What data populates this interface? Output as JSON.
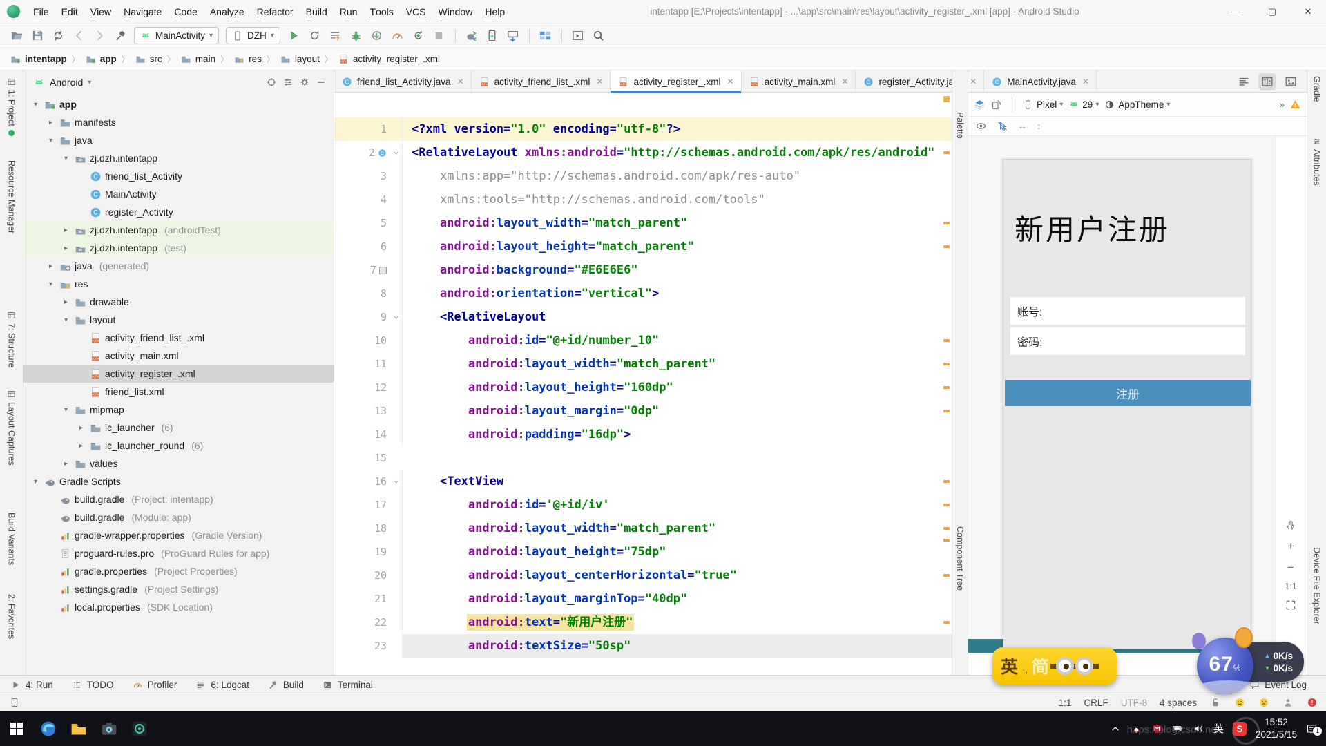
{
  "titlebar": {
    "menus": [
      {
        "label": "File",
        "u": 0
      },
      {
        "label": "Edit",
        "u": 0
      },
      {
        "label": "View",
        "u": 0
      },
      {
        "label": "Navigate",
        "u": 0
      },
      {
        "label": "Code",
        "u": 0
      },
      {
        "label": "Analyze",
        "u": 5
      },
      {
        "label": "Refactor",
        "u": 0
      },
      {
        "label": "Build",
        "u": 0
      },
      {
        "label": "Run",
        "u": 1
      },
      {
        "label": "Tools",
        "u": 0
      },
      {
        "label": "VCS",
        "u": 2
      },
      {
        "label": "Window",
        "u": 0
      },
      {
        "label": "Help",
        "u": 0
      }
    ],
    "title": "intentapp [E:\\Projects\\intentapp] - ...\\app\\src\\main\\res\\layout\\activity_register_.xml [app] - Android Studio",
    "window_buttons": [
      "minimize",
      "maximize",
      "close"
    ]
  },
  "toolbar": {
    "left_icons": [
      "open",
      "save",
      "sync",
      "back",
      "fwd",
      "hammer"
    ],
    "run_config": "MainActivity",
    "device": "DZH",
    "run_icons": [
      "play",
      "apply",
      "profilelines",
      "bug",
      "attachg",
      "gauge",
      "debugrestart",
      "stop"
    ],
    "tool_icons": [
      "syncgradle",
      "avd",
      "sdk"
    ],
    "extra_icons": [
      "structure"
    ],
    "last_icons": [
      "runwin",
      "search"
    ]
  },
  "breadcrumbs": [
    {
      "label": "intentapp",
      "icon": "module",
      "bold": true
    },
    {
      "label": "app",
      "icon": "module",
      "bold": true
    },
    {
      "label": "src",
      "icon": "folder"
    },
    {
      "label": "main",
      "icon": "folder"
    },
    {
      "label": "res",
      "icon": "res"
    },
    {
      "label": "layout",
      "icon": "folder"
    },
    {
      "label": "activity_register_.xml",
      "icon": "xml"
    }
  ],
  "left_stripe": [
    "1: Project",
    "Resource Manager",
    "7: Structure",
    "Layout Captures",
    "Build Variants",
    "2: Favorites"
  ],
  "right_stripe": [
    "Gradle",
    "Attributes",
    "Device File Explorer"
  ],
  "palette_strip": {
    "top": "Palette",
    "bottom": "Component Tree"
  },
  "project": {
    "selector": "Android",
    "tree": [
      {
        "indent": 0,
        "arrow": "down",
        "icon": "module",
        "label": "app",
        "bold": true
      },
      {
        "indent": 1,
        "arrow": "right",
        "icon": "folder",
        "label": "manifests"
      },
      {
        "indent": 1,
        "arrow": "down",
        "icon": "folder",
        "label": "java"
      },
      {
        "indent": 2,
        "arrow": "down",
        "icon": "pkg",
        "label": "zj.dzh.intentapp"
      },
      {
        "indent": 3,
        "icon": "class",
        "label": "friend_list_Activity"
      },
      {
        "indent": 3,
        "icon": "class",
        "label": "MainActivity"
      },
      {
        "indent": 3,
        "icon": "class",
        "label": "register_Activity"
      },
      {
        "indent": 2,
        "arrow": "right",
        "icon": "pkg",
        "label": "zj.dzh.intentapp",
        "extra": "(androidTest)",
        "bg": "green"
      },
      {
        "indent": 2,
        "arrow": "right",
        "icon": "pkg",
        "label": "zj.dzh.intentapp",
        "extra": "(test)",
        "bg": "green"
      },
      {
        "indent": 1,
        "arrow": "right",
        "icon": "gen",
        "label": "java",
        "extra": "(generated)"
      },
      {
        "indent": 1,
        "arrow": "down",
        "icon": "res",
        "label": "res"
      },
      {
        "indent": 2,
        "arrow": "right",
        "icon": "folder",
        "label": "drawable"
      },
      {
        "indent": 2,
        "arrow": "down",
        "icon": "folder",
        "label": "layout"
      },
      {
        "indent": 3,
        "icon": "xml",
        "label": "activity_friend_list_.xml"
      },
      {
        "indent": 3,
        "icon": "xml",
        "label": "activity_main.xml"
      },
      {
        "indent": 3,
        "icon": "xml",
        "label": "activity_register_.xml",
        "bg": "sel"
      },
      {
        "indent": 3,
        "icon": "xml",
        "label": "friend_list.xml"
      },
      {
        "indent": 2,
        "arrow": "down",
        "icon": "folder",
        "label": "mipmap"
      },
      {
        "indent": 3,
        "arrow": "right",
        "icon": "folder",
        "label": "ic_launcher",
        "extra": "(6)"
      },
      {
        "indent": 3,
        "arrow": "right",
        "icon": "folder",
        "label": "ic_launcher_round",
        "extra": "(6)"
      },
      {
        "indent": 2,
        "arrow": "right",
        "icon": "folder",
        "label": "values"
      },
      {
        "indent": 0,
        "arrow": "down",
        "icon": "gradle",
        "label": "Gradle Scripts"
      },
      {
        "indent": 1,
        "icon": "gradle",
        "label": "build.gradle",
        "extra": "(Project: intentapp)"
      },
      {
        "indent": 1,
        "icon": "gradle",
        "label": "build.gradle",
        "extra": "(Module: app)"
      },
      {
        "indent": 1,
        "icon": "props",
        "label": "gradle-wrapper.properties",
        "extra": "(Gradle Version)"
      },
      {
        "indent": 1,
        "icon": "file",
        "label": "proguard-rules.pro",
        "extra": "(ProGuard Rules for app)"
      },
      {
        "indent": 1,
        "icon": "props",
        "label": "gradle.properties",
        "extra": "(Project Properties)"
      },
      {
        "indent": 1,
        "icon": "props",
        "label": "settings.gradle",
        "extra": "(Project Settings)"
      },
      {
        "indent": 1,
        "icon": "props",
        "label": "local.properties",
        "extra": "(SDK Location)"
      }
    ]
  },
  "editor": {
    "tabs": [
      {
        "icon": "class",
        "label": "friend_list_Activity.java"
      },
      {
        "icon": "xml",
        "label": "activity_friend_list_.xml"
      },
      {
        "icon": "xml",
        "label": "activity_register_.xml",
        "active": true
      },
      {
        "icon": "xml",
        "label": "activity_main.xml"
      },
      {
        "icon": "class",
        "label": "register_Activity.java"
      },
      {
        "icon": "class",
        "label": "MainActivity.java"
      }
    ],
    "code": {
      "lines": [
        {
          "n": 1,
          "ind": 0,
          "bg": "cream",
          "seg": [
            [
              "<?xml version=",
              "t"
            ],
            [
              "\"1.0\"",
              "v"
            ],
            [
              " encoding=",
              "t"
            ],
            [
              "\"utf-8\"",
              "v"
            ],
            [
              "?>",
              "t"
            ]
          ]
        },
        {
          "n": 2,
          "ind": 0,
          "g": [
            "class",
            "fold"
          ],
          "seg": [
            [
              "<RelativeLayout ",
              "t"
            ],
            [
              "xmlns:android",
              "ns"
            ],
            [
              "=",
              "t"
            ],
            [
              "\"http://schemas.android.com/apk/res/android\"",
              "v"
            ]
          ]
        },
        {
          "n": 3,
          "ind": 1,
          "seg": [
            [
              "xmlns:app=\"http://schemas.android.com/apk/res-auto\"",
              "g"
            ]
          ]
        },
        {
          "n": 4,
          "ind": 1,
          "seg": [
            [
              "xmlns:tools=\"http://schemas.android.com/tools\"",
              "g"
            ]
          ]
        },
        {
          "n": 5,
          "ind": 1,
          "seg": [
            [
              "android:",
              "ns"
            ],
            [
              "layout_width",
              "a"
            ],
            [
              "=",
              "t"
            ],
            [
              "\"match_parent\"",
              "v"
            ]
          ]
        },
        {
          "n": 6,
          "ind": 1,
          "seg": [
            [
              "android:",
              "ns"
            ],
            [
              "layout_height",
              "a"
            ],
            [
              "=",
              "t"
            ],
            [
              "\"match_parent\"",
              "v"
            ]
          ]
        },
        {
          "n": 7,
          "ind": 1,
          "g": [
            "chip"
          ],
          "seg": [
            [
              "android:",
              "ns"
            ],
            [
              "background",
              "a"
            ],
            [
              "=",
              "t"
            ],
            [
              "\"#E6E6E6\"",
              "v"
            ]
          ]
        },
        {
          "n": 8,
          "ind": 1,
          "seg": [
            [
              "android:",
              "ns"
            ],
            [
              "orientation",
              "a"
            ],
            [
              "=",
              "t"
            ],
            [
              "\"vertical\"",
              "v"
            ],
            [
              ">",
              "t"
            ]
          ]
        },
        {
          "n": 9,
          "ind": 1,
          "g": [
            "fold"
          ],
          "seg": [
            [
              "<RelativeLayout",
              "t"
            ]
          ]
        },
        {
          "n": 10,
          "ind": 2,
          "seg": [
            [
              "android:",
              "ns"
            ],
            [
              "id",
              "a"
            ],
            [
              "=",
              "t"
            ],
            [
              "\"@+id/number_10\"",
              "v"
            ]
          ]
        },
        {
          "n": 11,
          "ind": 2,
          "seg": [
            [
              "android:",
              "ns"
            ],
            [
              "layout_width",
              "a"
            ],
            [
              "=",
              "t"
            ],
            [
              "\"match_parent\"",
              "v"
            ]
          ]
        },
        {
          "n": 12,
          "ind": 2,
          "seg": [
            [
              "android:",
              "ns"
            ],
            [
              "layout_height",
              "a"
            ],
            [
              "=",
              "t"
            ],
            [
              "\"160dp\"",
              "v"
            ]
          ]
        },
        {
          "n": 13,
          "ind": 2,
          "seg": [
            [
              "android:",
              "ns"
            ],
            [
              "layout_margin",
              "a"
            ],
            [
              "=",
              "t"
            ],
            [
              "\"0dp\"",
              "v"
            ]
          ]
        },
        {
          "n": 14,
          "ind": 2,
          "seg": [
            [
              "android:",
              "ns"
            ],
            [
              "padding",
              "a"
            ],
            [
              "=",
              "t"
            ],
            [
              "\"16dp\"",
              "v"
            ],
            [
              ">",
              "t"
            ]
          ]
        },
        {
          "n": 15,
          "ind": 0,
          "seg": []
        },
        {
          "n": 16,
          "ind": 1,
          "g": [
            "fold"
          ],
          "seg": [
            [
              "<TextView",
              "t"
            ]
          ]
        },
        {
          "n": 17,
          "ind": 2,
          "seg": [
            [
              "android:",
              "ns"
            ],
            [
              "id",
              "a"
            ],
            [
              "=",
              "t"
            ],
            [
              "'@+id/iv'",
              "v"
            ]
          ]
        },
        {
          "n": 18,
          "ind": 2,
          "seg": [
            [
              "android:",
              "ns"
            ],
            [
              "layout_width",
              "a"
            ],
            [
              "=",
              "t"
            ],
            [
              "\"match_parent\"",
              "v"
            ]
          ]
        },
        {
          "n": 19,
          "ind": 2,
          "seg": [
            [
              "android:",
              "ns"
            ],
            [
              "layout_height",
              "a"
            ],
            [
              "=",
              "t"
            ],
            [
              "\"75dp\"",
              "v"
            ]
          ]
        },
        {
          "n": 20,
          "ind": 2,
          "seg": [
            [
              "android:",
              "ns"
            ],
            [
              "layout_centerHorizontal",
              "a"
            ],
            [
              "=",
              "t"
            ],
            [
              "\"true\"",
              "v"
            ]
          ]
        },
        {
          "n": 21,
          "ind": 2,
          "seg": [
            [
              "android:",
              "ns"
            ],
            [
              "layout_marginTop",
              "a"
            ],
            [
              "=",
              "t"
            ],
            [
              "\"40dp\"",
              "v"
            ]
          ]
        },
        {
          "n": 22,
          "ind": 2,
          "mark": true,
          "seg": [
            [
              "android:",
              "ns"
            ],
            [
              "text",
              "a"
            ],
            [
              "=",
              "t"
            ],
            [
              "\"新用户注册\"",
              "v"
            ]
          ]
        },
        {
          "n": 23,
          "ind": 2,
          "bg": "gray",
          "seg": [
            [
              "android:",
              "ns"
            ],
            [
              "textSize",
              "a"
            ],
            [
              "=",
              "t"
            ],
            [
              "\"50sp\"",
              "v"
            ]
          ]
        }
      ],
      "stripe_lines": [
        2,
        5,
        6,
        10,
        11,
        12,
        13,
        16,
        17,
        18,
        18.5,
        20,
        22
      ]
    }
  },
  "design": {
    "device": "Pixel",
    "api": "29",
    "theme": "AppTheme",
    "overflow": "»",
    "preview": {
      "title": "新用户注册",
      "fields": [
        "账号:",
        "密码:"
      ],
      "button": "注册"
    },
    "zoom_label": "1:1"
  },
  "bottom_bar": {
    "items": [
      {
        "label": "4: Run",
        "u": 0,
        "icon": "playgray"
      },
      {
        "label": "TODO",
        "icon": "todo"
      },
      {
        "label": "Profiler",
        "icon": "gauge"
      },
      {
        "label": "6: Logcat",
        "u": 0,
        "icon": "logcat"
      },
      {
        "label": "Build",
        "icon": "hammerg"
      },
      {
        "label": "Terminal",
        "icon": "terminal"
      }
    ],
    "right": {
      "label": "Event Log",
      "icon": "bubble"
    }
  },
  "status_bar": {
    "items": [
      "1:1",
      "CRLF",
      "UTF-8",
      "4 spaces"
    ],
    "muted": "UTF-8"
  },
  "taskbar": {
    "clock": {
      "time": "15:52",
      "date": "2021/5/15"
    },
    "ime": "英",
    "notification_count": "1",
    "watermark": "https://blog.csdn.net/"
  },
  "widgets": {
    "translate": {
      "from": "英",
      "to": "简"
    },
    "ball": {
      "value": "67",
      "unit": "%"
    },
    "net": {
      "up": "0K/s",
      "down": "0K/s"
    }
  },
  "theme": {
    "accent_blue": "#4083c9",
    "button_blue": "#4b90bd",
    "teal_bar": "#2f7e8d",
    "highlight_yellow": "#f5e4a0",
    "line_highlight": "#fbf5d3",
    "phone_bg": "#e7e7e7",
    "selection_gray": "#d4d4d4",
    "test_green": "#edf6e3",
    "background_value": "#E6E6E6"
  }
}
